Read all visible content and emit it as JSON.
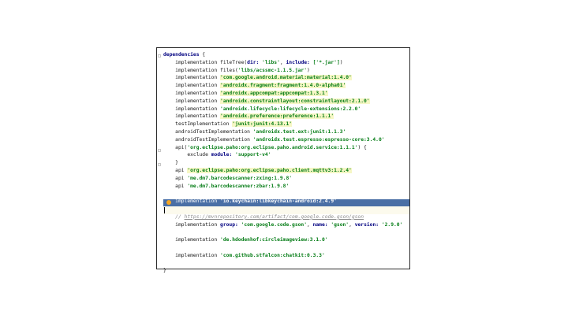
{
  "editor": {
    "lines": [
      {
        "kw": "dependencies",
        "rest": " {"
      },
      {
        "indent": "    ",
        "pre": "implementation fileTree(",
        "kw2": "dir:",
        "s1": " 'libs'",
        ",": ", ",
        "kw3": "include:",
        "s2": " ['*.jar']",
        "end": ")"
      },
      {
        "indent": "    ",
        "pre": "implementation files(",
        "s1": "'libs/acssmc-1.1.5.jar'",
        "end": ")"
      },
      {
        "indent": "    ",
        "pre": "implementation ",
        "s1": "'com.google.android.material:material:1.4.0'",
        "hl": true
      },
      {
        "indent": "    ",
        "pre": "implementation ",
        "s1": "'androidx.fragment:fragment:1.4.0-alpha01'",
        "hl": true
      },
      {
        "indent": "    ",
        "pre": "implementation ",
        "s1": "'androidx.appcompat:appcompat:1.3.1'",
        "hl": true
      },
      {
        "indent": "    ",
        "pre": "implementation ",
        "s1": "'androidx.constraintlayout:constraintlayout:2.1.0'",
        "hl": true
      },
      {
        "indent": "    ",
        "pre": "implementation ",
        "s1": "'androidx.lifecycle:lifecycle-extensions:2.2.0'"
      },
      {
        "indent": "    ",
        "pre": "implementation ",
        "s1": "'androidx.preference:preference:1.1.1'",
        "hl": true
      },
      {
        "indent": "    ",
        "pre": "testImplementation ",
        "s1": "'junit:junit:4.13.1'",
        "hl": true
      },
      {
        "indent": "    ",
        "pre": "androidTestImplementation ",
        "s1": "'androidx.test.ext:junit:1.1.3'"
      },
      {
        "indent": "    ",
        "pre": "androidTestImplementation ",
        "s1": "'androidx.test.espresso:espresso-core:3.4.0'"
      },
      {
        "indent": "    ",
        "pre": "api(",
        "s1": "'org.eclipse.paho:org.eclipse.paho.android.service:1.1.1'",
        "end": ") {"
      },
      {
        "indent": "        ",
        "pre": "exclude ",
        "kw2": "module:",
        "s1": " 'support-v4'"
      },
      {
        "indent": "    ",
        "pre": "}"
      },
      {
        "indent": "    ",
        "pre": "api ",
        "s1": "'org.eclipse.paho:org.eclipse.paho.client.mqttv3:1.2.4'",
        "hl": true
      },
      {
        "indent": "    ",
        "pre": "api ",
        "s1": "'me.dm7.barcodescanner:zxing:1.9.8'"
      },
      {
        "indent": "    ",
        "pre": "api ",
        "s1": "'me.dm7.barcodescanner:zbar:1.9.8'"
      },
      {
        "blank": true
      },
      {
        "indent": "    ",
        "pre": "implementation ",
        "s1": "'io.keychain:libkeychain-android:2.4.9'",
        "selected": true
      },
      {
        "blank": true
      },
      {
        "indent": "    ",
        "comment": "// ",
        "link": "https://mvnrepository.com/artifact/com.google.code.gson/gson"
      },
      {
        "indent": "    ",
        "pre": "implementation ",
        "kw2": "group:",
        "s1": " 'com.google.code.gson'",
        ",": ", ",
        "kw3": "name:",
        "s2": " 'gson'",
        ",2": ", ",
        "kw4": "version:",
        "s3": " '2.9.0'"
      },
      {
        "blank": true
      },
      {
        "indent": "    ",
        "pre": "implementation ",
        "s1": "'de.hdodenhof:circleimageview:3.1.0'"
      },
      {
        "blank": true
      },
      {
        "indent": "    ",
        "pre": "implementation ",
        "s1": "'com.github.stfalcon:chatkit:0.3.3'"
      },
      {
        "blank": true
      },
      {
        "pre": "}"
      }
    ]
  }
}
